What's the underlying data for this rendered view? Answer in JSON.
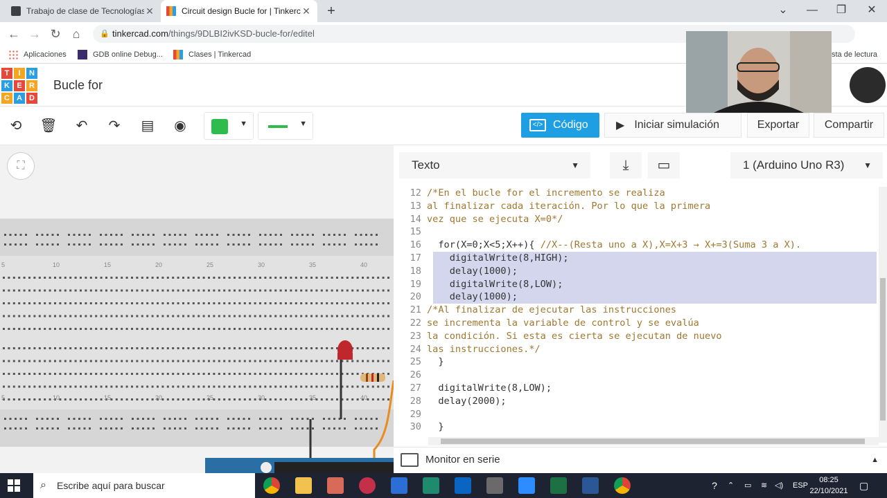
{
  "browser": {
    "tabs": [
      {
        "title": "Trabajo de clase de Tecnologías"
      },
      {
        "title": "Circuit design Bucle for | Tinkercad"
      }
    ],
    "url_host": "tinkercad.com",
    "url_path": "/things/9DLBI2ivKSD-bucle-for/editel",
    "bookmarks": [
      "Aplicaciones",
      "GDB online Debug...",
      "Clases | Tinkercad"
    ],
    "reading_list": "sta de lectura"
  },
  "app": {
    "logo_letters": [
      "T",
      "I",
      "N",
      "K",
      "E",
      "R",
      "C",
      "A",
      "D"
    ],
    "logo_colors": [
      "#e4493b",
      "#f4a522",
      "#2a9ee0",
      "#2a9ee0",
      "#e4493b",
      "#f4a522",
      "#f4a522",
      "#2a9ee0",
      "#e4493b"
    ],
    "design_title": "Bucle for"
  },
  "toolbar": {
    "wire_color": "#2ebd4c",
    "code_label": "Código",
    "sim_label": "Iniciar simulación",
    "export_label": "Exportar",
    "share_label": "Compartir"
  },
  "code_panel": {
    "mode": "Texto",
    "board": "1 (Arduino Uno R3)",
    "monitor_label": "Monitor en serie",
    "lines": [
      {
        "n": "12",
        "text": "/*En el bucle for el incremento se realiza",
        "kind": "comment"
      },
      {
        "n": "13",
        "text": "al finalizar cada iteración. Por lo que la primera",
        "kind": "comment"
      },
      {
        "n": "14",
        "text": "vez que se ejecuta X=0*/",
        "kind": "comment"
      },
      {
        "n": "15",
        "text": "",
        "kind": "code"
      },
      {
        "n": "16",
        "text": "  for(X=0;X<5;X++){ ",
        "comment": "//X--(Resta uno a X),X=X+3 → X+=3(Suma 3 a X).",
        "kind": "mixed"
      },
      {
        "n": "17",
        "text": "    digitalWrite(8,HIGH);",
        "kind": "code",
        "hl": true
      },
      {
        "n": "18",
        "text": "    delay(1000);",
        "kind": "code",
        "hl": true
      },
      {
        "n": "19",
        "text": "    digitalWrite(8,LOW);",
        "kind": "code",
        "hl": true
      },
      {
        "n": "20",
        "text": "    delay(1000);",
        "kind": "code",
        "hl": true
      },
      {
        "n": "21",
        "text": "/*Al finalizar de ejecutar las instrucciones",
        "kind": "comment"
      },
      {
        "n": "22",
        "text": "se incrementa la variable de control y se evalúa",
        "kind": "comment"
      },
      {
        "n": "23",
        "text": "la condición. Si esta es cierta se ejecutan de nuevo",
        "kind": "comment"
      },
      {
        "n": "24",
        "text": "las instrucciones.*/",
        "kind": "comment"
      },
      {
        "n": "25",
        "text": "  }",
        "kind": "code"
      },
      {
        "n": "26",
        "text": "",
        "kind": "code"
      },
      {
        "n": "27",
        "text": "  digitalWrite(8,LOW);",
        "kind": "code"
      },
      {
        "n": "28",
        "text": "  delay(2000);",
        "kind": "code"
      },
      {
        "n": "29",
        "text": "",
        "kind": "code"
      },
      {
        "n": "30",
        "text": "  }",
        "kind": "code"
      }
    ]
  },
  "breadboard": {
    "column_labels": [
      "5",
      "10",
      "15",
      "20",
      "25",
      "30",
      "35",
      "40"
    ]
  },
  "taskbar": {
    "search_placeholder": "Escribe aquí para buscar",
    "language": "ESP",
    "time": "08:25",
    "date": "22/10/2021"
  }
}
